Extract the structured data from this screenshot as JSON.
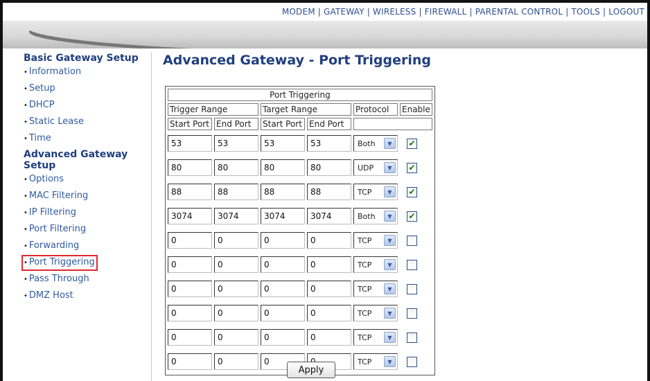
{
  "topnav": [
    "MODEM",
    "GATEWAY",
    "WIRELESS",
    "FIREWALL",
    "PARENTAL CONTROL",
    "TOOLS",
    "LOGOUT"
  ],
  "sidebar": {
    "section1": {
      "title": "Basic Gateway Setup",
      "items": [
        "Information",
        "Setup",
        "DHCP",
        "Static Lease",
        "Time"
      ]
    },
    "section2": {
      "title": "Advanced Gateway Setup",
      "items": [
        "Options",
        "MAC Filtering",
        "IP Filtering",
        "Port Filtering",
        "Forwarding",
        "Port Triggering",
        "Pass Through",
        "DMZ Host"
      ]
    },
    "selected": "Port Triggering"
  },
  "page_title": "Advanced Gateway - Port Triggering",
  "table": {
    "caption": "Port Triggering",
    "group_headers": {
      "trigger": "Trigger Range",
      "target": "Target Range",
      "protocol": "Protocol",
      "enable": "Enable"
    },
    "sub_headers": [
      "Start Port",
      "End Port",
      "Start Port",
      "End Port"
    ],
    "rows": [
      {
        "trig_start": "53",
        "trig_end": "53",
        "targ_start": "53",
        "targ_end": "53",
        "protocol": "Both",
        "enabled": true
      },
      {
        "trig_start": "80",
        "trig_end": "80",
        "targ_start": "80",
        "targ_end": "80",
        "protocol": "UDP",
        "enabled": true
      },
      {
        "trig_start": "88",
        "trig_end": "88",
        "targ_start": "88",
        "targ_end": "88",
        "protocol": "TCP",
        "enabled": true
      },
      {
        "trig_start": "3074",
        "trig_end": "3074",
        "targ_start": "3074",
        "targ_end": "3074",
        "protocol": "Both",
        "enabled": true
      },
      {
        "trig_start": "0",
        "trig_end": "0",
        "targ_start": "0",
        "targ_end": "0",
        "protocol": "TCP",
        "enabled": false
      },
      {
        "trig_start": "0",
        "trig_end": "0",
        "targ_start": "0",
        "targ_end": "0",
        "protocol": "TCP",
        "enabled": false
      },
      {
        "trig_start": "0",
        "trig_end": "0",
        "targ_start": "0",
        "targ_end": "0",
        "protocol": "TCP",
        "enabled": false
      },
      {
        "trig_start": "0",
        "trig_end": "0",
        "targ_start": "0",
        "targ_end": "0",
        "protocol": "TCP",
        "enabled": false
      },
      {
        "trig_start": "0",
        "trig_end": "0",
        "targ_start": "0",
        "targ_end": "0",
        "protocol": "TCP",
        "enabled": false
      },
      {
        "trig_start": "0",
        "trig_end": "0",
        "targ_start": "0",
        "targ_end": "0",
        "protocol": "TCP",
        "enabled": false
      }
    ]
  },
  "apply_label": "Apply",
  "colors": {
    "link": "#2f5aa0",
    "heading": "#1f3f7f",
    "selection_box": "#e0282e",
    "check": "#1a7a1a"
  }
}
